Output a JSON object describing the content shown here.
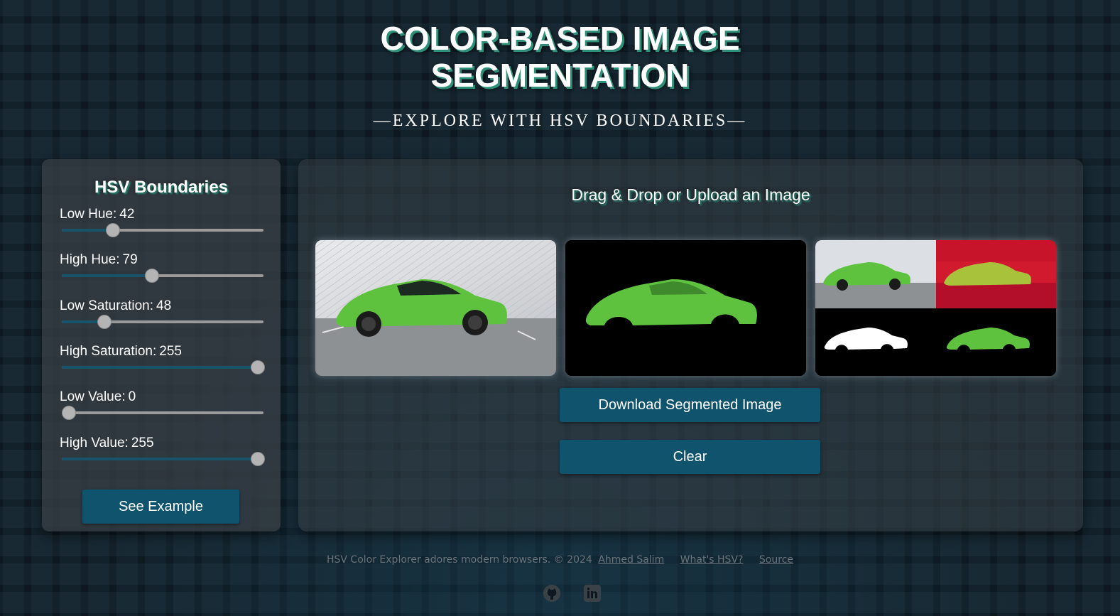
{
  "header": {
    "title_line1": "COLOR-BASED IMAGE",
    "title_line2": "SEGMENTATION",
    "subtitle": "—EXPLORE WITH HSV BOUNDARIES—"
  },
  "controls": {
    "heading": "HSV Boundaries",
    "sliders": [
      {
        "label": "Low Hue:",
        "value": "42",
        "max": 179
      },
      {
        "label": "High Hue:",
        "value": "79",
        "max": 179
      },
      {
        "label": "Low Saturation:",
        "value": "48",
        "max": 255
      },
      {
        "label": "High Saturation:",
        "value": "255",
        "max": 255
      },
      {
        "label": "Low Value:",
        "value": "0",
        "max": 255
      },
      {
        "label": "High Value:",
        "value": "255",
        "max": 255
      }
    ],
    "example_button": "See Example"
  },
  "workspace": {
    "drop_heading": "Drag & Drop or Upload an Image",
    "images": [
      {
        "name": "original-image"
      },
      {
        "name": "segmented-image"
      },
      {
        "name": "composite-image"
      }
    ],
    "download_button": "Download Segmented Image",
    "clear_button": "Clear"
  },
  "footer": {
    "text": "HSV Color Explorer adores modern browsers. © 2024",
    "author_link": "Ahmed Salim",
    "hsv_link": "What's HSV?",
    "source_link": "Source",
    "icons": [
      "github-icon",
      "linkedin-icon"
    ]
  },
  "colors": {
    "accent_button": "#0f536d",
    "slider_fill": "#17546a",
    "car_green": "#5ec23e",
    "title_shadow": "#2e8f78"
  }
}
